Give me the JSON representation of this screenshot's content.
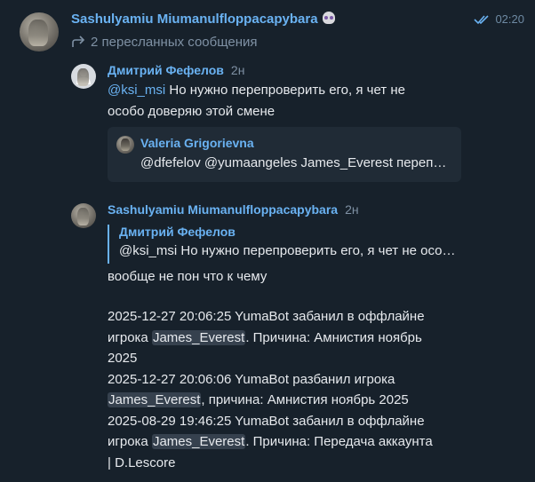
{
  "header": {
    "sender_name": "Sashulyamiu Miumanulfloppacapybara",
    "sender_emoji_icon": "skull-icon",
    "time": "02:20",
    "read_status_icon": "double-check-icon",
    "forwarded_label": "2 пересланных сообщения"
  },
  "messages": [
    {
      "author": "Дмитрий Фефелов",
      "ago": "2н",
      "mention": "@ksi_msi",
      "line1": " Но нужно перепроверить его, я чет не",
      "line2": "особо доверяю этой смене",
      "quote": {
        "author": "Valeria Grigorievna",
        "text": "@dfefelov @yumaangeles James_Everest перепроверь"
      }
    },
    {
      "author": "Sashulyamiu Miumanulfloppacapybara",
      "ago": "2н",
      "reply": {
        "author": "Дмитрий Фефелов",
        "text": "@ksi_msi Но нужно перепроверить его, я чет не особо доверяю этой смене"
      },
      "body": "вообще не пон что к чему",
      "log": {
        "e1_a": "2025-12-27 20:06:25   YumaBot забанил в оффлайне",
        "e1_b": "игрока ",
        "e1_name": "James_Everest",
        "e1_c": ". Причина: Амнистия ноябрь",
        "e1_d": "2025",
        "e2_a": "2025-12-27 20:06:06   YumaBot разбанил игрока",
        "e2_name": "James_Everest",
        "e2_b": ", причина: Амнистия ноябрь 2025",
        "e3_a": "2025-08-29 19:46:25   YumaBot забанил в оффлайне",
        "e3_b": "игрока ",
        "e3_name": "James_Everest",
        "e3_c": ". Причина: Передача аккаунта",
        "e3_d": "| D.Lescore"
      }
    }
  ],
  "colors": {
    "background": "#17212b",
    "accent": "#6ab2f2",
    "muted": "#7f91a4",
    "text": "#e6e9ed",
    "quote_bg": "#202b36",
    "highlight_bg": "#36414e"
  }
}
